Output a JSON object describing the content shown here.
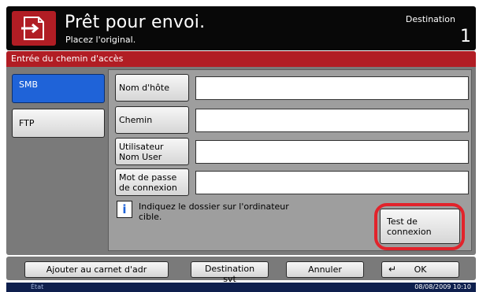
{
  "header": {
    "title": "Prêt pour envoi.",
    "subtitle": "Placez l'original.",
    "destination_label": "Destination",
    "destination_count": "1"
  },
  "panel": {
    "title": "Entrée du chemin d'accès",
    "tabs": [
      {
        "label": "SMB",
        "selected": true
      },
      {
        "label": "FTP",
        "selected": false
      }
    ],
    "fields": [
      {
        "label": "Nom d'hôte",
        "value": ""
      },
      {
        "label": "Chemin",
        "value": ""
      },
      {
        "label": "Utilisateur\nNom User",
        "value": ""
      },
      {
        "label": "Mot de passe\nde connexion",
        "value": ""
      }
    ],
    "info_icon": "info-icon",
    "info_text": "Indiquez le dossier sur l'ordinateur cible.",
    "test_button": "Test de\nconnexion"
  },
  "toolbar": {
    "add_address_book": "Ajouter au carnet d'adr",
    "next_destination": "Destination svt",
    "cancel": "Annuler",
    "ok": "OK",
    "ok_icon": "return-arrow-icon"
  },
  "status": {
    "state": "État",
    "datetime": "08/08/2009   10:10"
  },
  "colors": {
    "accent_red": "#b11d24",
    "selected_blue": "#1f63d8",
    "highlight_ring": "#e2232b"
  }
}
